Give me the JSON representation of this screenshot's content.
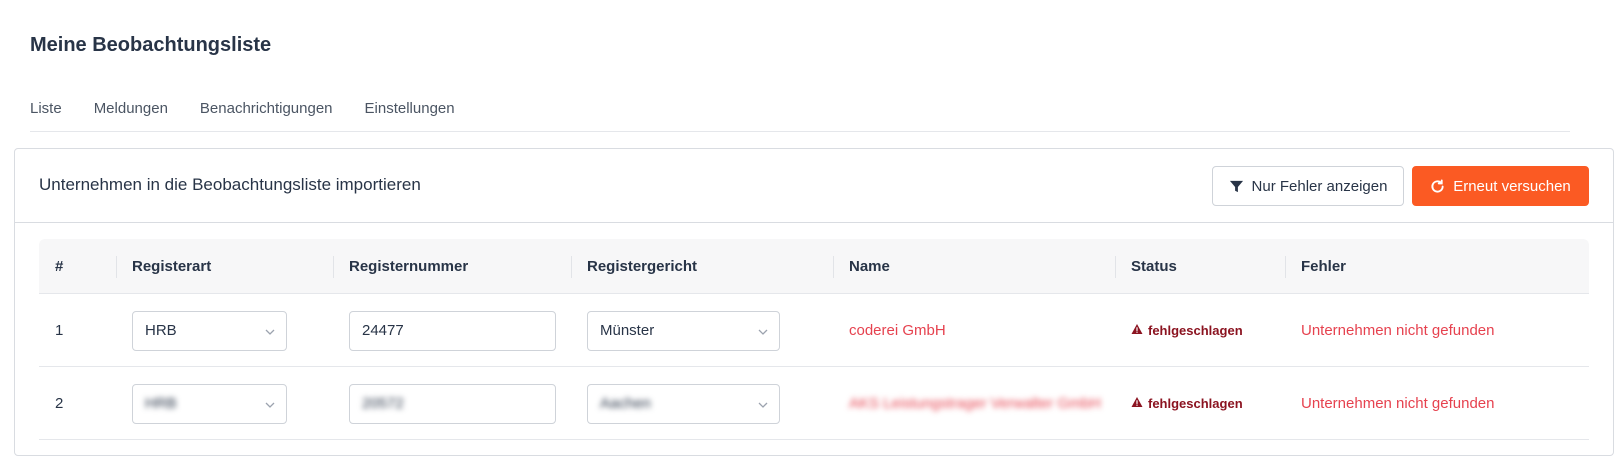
{
  "page": {
    "title": "Meine Beobachtungsliste"
  },
  "tabs": [
    {
      "label": "Liste"
    },
    {
      "label": "Meldungen"
    },
    {
      "label": "Benachrichtigungen"
    },
    {
      "label": "Einstellungen"
    }
  ],
  "card": {
    "title": "Unternehmen in die Beobachtungsliste importieren",
    "filter_button": "Nur Fehler anzeigen",
    "retry_button": "Erneut versuchen"
  },
  "colors": {
    "accent": "#fb5a23",
    "error": "#e6424f",
    "status_error": "#8b1320"
  },
  "table": {
    "headers": {
      "num": "#",
      "registerart": "Registerart",
      "registernummer": "Registernummer",
      "registergericht": "Registergericht",
      "name": "Name",
      "status": "Status",
      "fehler": "Fehler"
    },
    "rows": [
      {
        "num": "1",
        "registerart": "HRB",
        "registernummer": "24477",
        "registergericht": "Münster",
        "name": "coderei GmbH",
        "status": "fehlgeschlagen",
        "fehler": "Unternehmen nicht gefunden"
      },
      {
        "num": "2",
        "registerart": "HRB",
        "registernummer": "20572",
        "registergericht": "Aachen",
        "name": "AKS Leistungstrager Verwalter GmbH",
        "status": "fehlgeschlagen",
        "fehler": "Unternehmen nicht gefunden"
      }
    ]
  }
}
